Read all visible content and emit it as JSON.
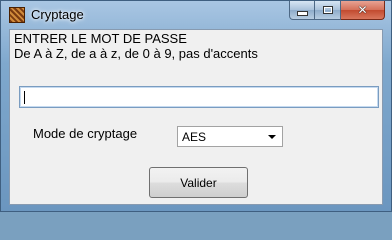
{
  "window": {
    "title": "Cryptage",
    "buttons": {
      "minimize": "–",
      "maximize": "□",
      "close": "✕"
    }
  },
  "form": {
    "prompt_line1": "ENTRER LE MOT DE PASSE",
    "prompt_line2": "De A à  Z, de a à z, de 0 à 9, pas d'accents",
    "password_value": "",
    "mode_label": "Mode de cryptage",
    "mode_selected": "AES",
    "submit_label": "Valider"
  },
  "icons": {
    "app": "cryptage-app-icon",
    "dropdown": "chevron-down-icon"
  }
}
